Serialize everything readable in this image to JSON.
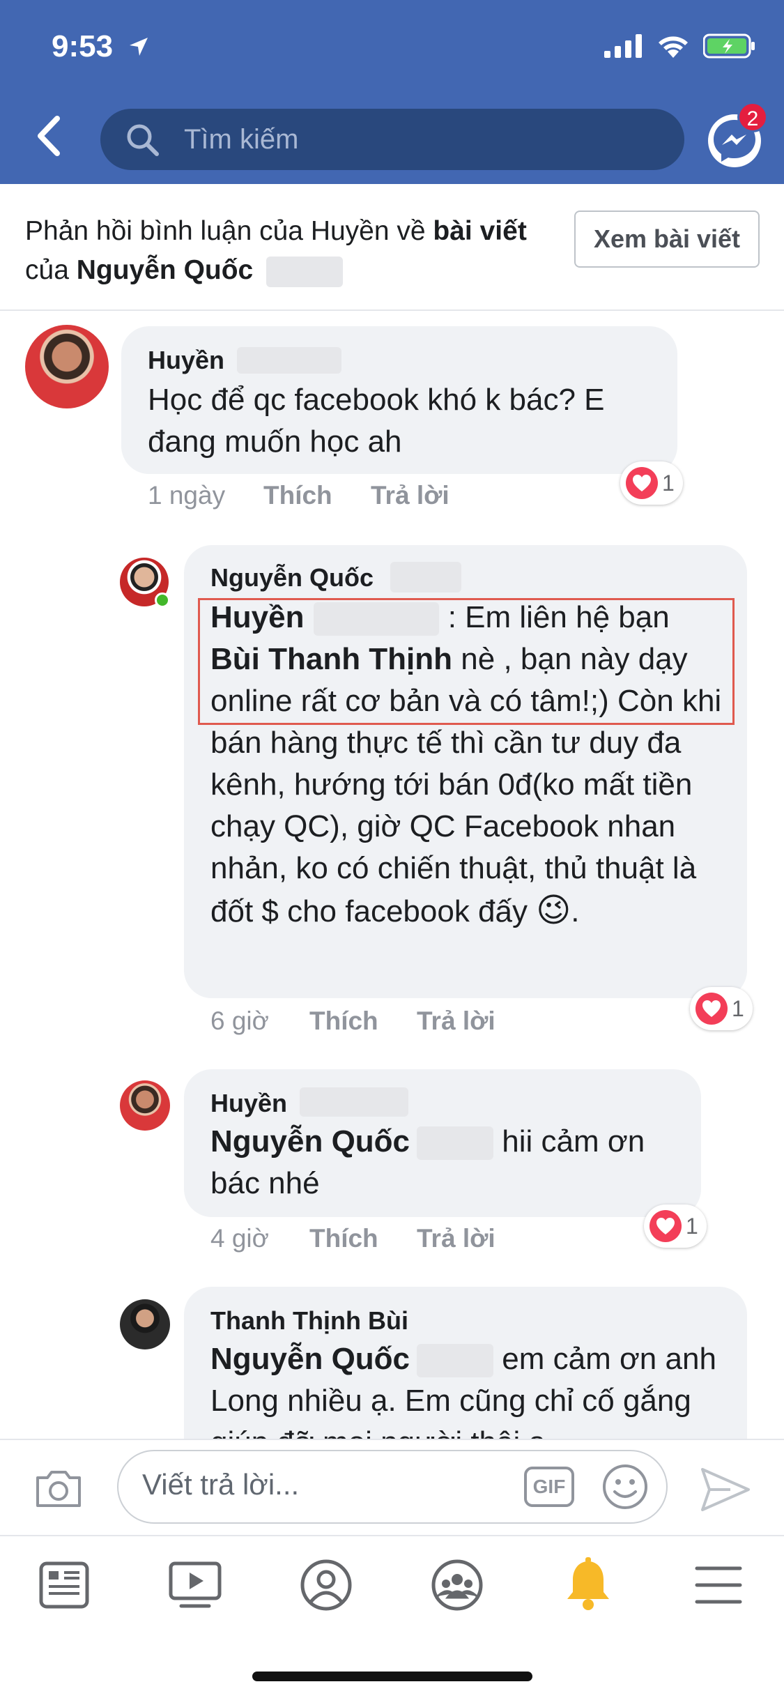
{
  "status_bar": {
    "time": "9:53"
  },
  "header": {
    "search_placeholder": "Tìm kiếm",
    "messenger_badge": "2"
  },
  "context": {
    "prefix": "Phản hồi bình luận của Huyền về ",
    "bold_1": "bài viết",
    "middle": " của ",
    "bold_2": "Nguyễn Quốc",
    "button": "Xem bài viết"
  },
  "comments": [
    {
      "author": "Huyền",
      "text": "Học để qc facebook khó k bác? E đang muốn học ah",
      "time": "1 ngày",
      "like": "Thích",
      "reply": "Trả lời",
      "reactions": "1"
    },
    {
      "author": "Nguyễn Quốc",
      "mention_1": "Huyền",
      "text_1": " : Em liên hệ bạn ",
      "mention_2": "Bùi Thanh Thịnh",
      "text_2": " nè , bạn này dạy online rất cơ bản và có tâm!;) Còn khi bán hàng thực tế thì cần tư duy đa kênh, hướng tới bán 0đ(ko mất tiền chạy QC), giờ QC Facebook nhan nhản, ko có chiến thuật, thủ thuật là đốt $ cho facebook đấy",
      "emoji": "😉",
      "text_3": ".",
      "time": "6 giờ",
      "like": "Thích",
      "reply": "Trả lời",
      "reactions": "1"
    },
    {
      "author": "Huyền",
      "mention": "Nguyễn Quốc",
      "text": " hii cảm ơn bác nhé",
      "time": "4 giờ",
      "like": "Thích",
      "reply": "Trả lời",
      "reactions": "1"
    },
    {
      "author": "Thanh Thịnh Bùi",
      "mention": "Nguyễn Quốc",
      "text": " em cảm ơn anh Long nhiều ạ. Em cũng chỉ cố gắng giúp đỡ mọi người thôi ạ"
    }
  ],
  "composer": {
    "placeholder": "Viết trả lời...",
    "gif": "GIF"
  },
  "colors": {
    "brand_blue": "#4267b2",
    "search_bg": "#29487d",
    "bubble_bg": "#f0f2f5",
    "heart_red": "#f33e58",
    "notification_yellow": "#f7b928",
    "highlight_border": "#e05a4f"
  },
  "icons": {
    "back": "chevron-left-icon",
    "search": "search-icon",
    "messenger": "messenger-icon",
    "camera": "camera-icon",
    "gif": "gif-icon",
    "emoji": "emoji-icon",
    "send": "send-icon",
    "tabs": [
      "news-feed-icon",
      "watch-icon",
      "profile-icon",
      "groups-icon",
      "notifications-bell-icon",
      "menu-icon"
    ]
  }
}
